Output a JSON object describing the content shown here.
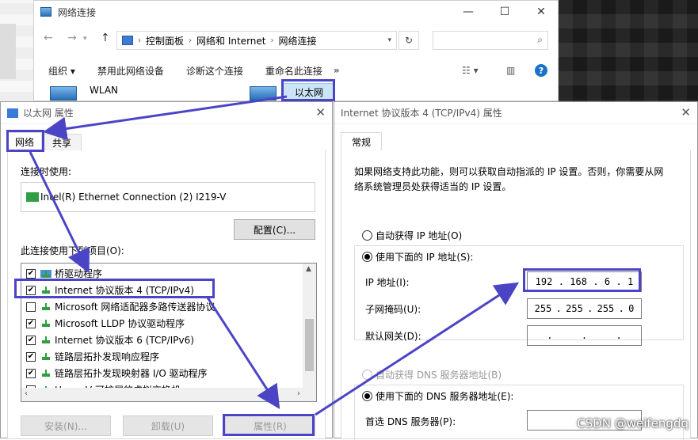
{
  "explorer": {
    "title": "网络连接",
    "breadcrumb": [
      "控制面板",
      "网络和 Internet",
      "网络连接"
    ],
    "commands": [
      "组织",
      "禁用此网络设备",
      "诊断这个连接",
      "重命名此连接"
    ],
    "more": "»",
    "items": [
      "WLAN",
      "以太网"
    ]
  },
  "props_dialog": {
    "title": "以太网 属性",
    "tabs": [
      "网络",
      "共享"
    ],
    "connect_using_label": "连接时使用:",
    "adapter_name": "Intel(R) Ethernet Connection (2) I219-V",
    "configure_button": "配置(C)...",
    "items_label": "此连接使用下列项目(O):",
    "items": [
      {
        "label": "桥驱动程序",
        "checked": true
      },
      {
        "label": "Internet 协议版本 4 (TCP/IPv4)",
        "checked": true
      },
      {
        "label": "Microsoft 网络适配器多路传送器协议",
        "checked": false
      },
      {
        "label": "Microsoft LLDP 协议驱动程序",
        "checked": true
      },
      {
        "label": "Internet 协议版本 6 (TCP/IPv6)",
        "checked": true
      },
      {
        "label": "链路层拓扑发现响应程序",
        "checked": true
      },
      {
        "label": "链路层拓扑发现映射器 I/O 驱动程序",
        "checked": true
      },
      {
        "label": "Hyper-V 可扩展的虚拟交换机",
        "checked": false
      }
    ],
    "install_button": "安装(N)...",
    "uninstall_button": "卸载(U)",
    "properties_button": "属性(R)"
  },
  "ipv4_dialog": {
    "title": "Internet 协议版本 4 (TCP/IPv4) 属性",
    "tab": "常规",
    "description": "如果网络支持此功能，则可以获取自动指派的 IP 设置。否则，你需要从网络系统管理员处获得适当的 IP 设置。",
    "auto_ip": "自动获得 IP 地址(O)",
    "manual_ip": "使用下面的 IP 地址(S):",
    "ip_label": "IP 地址(I):",
    "ip_value": [
      "192",
      "168",
      "6",
      "1"
    ],
    "mask_label": "子网掩码(U):",
    "mask_value": [
      "255",
      "255",
      "255",
      "0"
    ],
    "gateway_label": "默认网关(D):",
    "auto_dns": "自动获得 DNS 服务器地址(B)",
    "manual_dns": "使用下面的 DNS 服务器地址(E):",
    "dns_label": "首选 DNS 服务器(P):"
  },
  "watermark": "CSDN @weifengdq",
  "colors": {
    "highlight": "#4b45c6",
    "accent": "#0078d7"
  }
}
